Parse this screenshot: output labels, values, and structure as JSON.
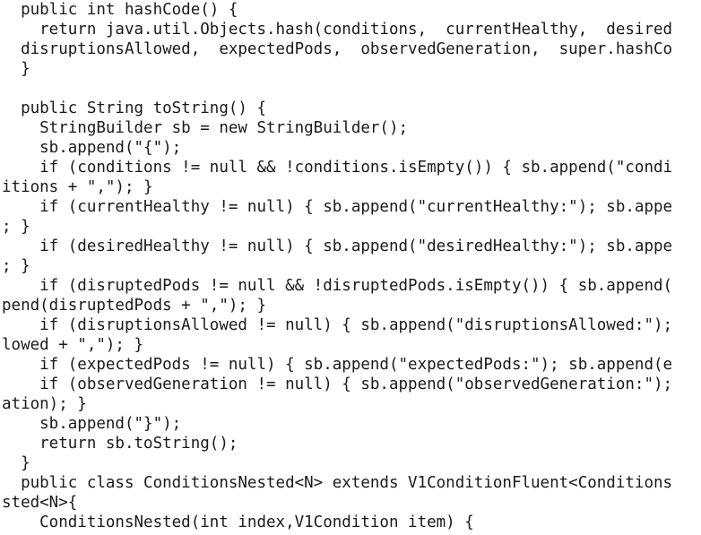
{
  "editor": {
    "lines": [
      "  public int hashCode() {",
      "    return java.util.Objects.hash(conditions,  currentHealthy,  desired",
      "  disruptionsAllowed,  expectedPods,  observedGeneration,  super.hashCo",
      "  }",
      "",
      "  public String toString() {",
      "    StringBuilder sb = new StringBuilder();",
      "    sb.append(\"{\");",
      "    if (conditions != null && !conditions.isEmpty()) { sb.append(\"condi",
      "itions + \",\"); }",
      "    if (currentHealthy != null) { sb.append(\"currentHealthy:\"); sb.appe",
      "; }",
      "    if (desiredHealthy != null) { sb.append(\"desiredHealthy:\"); sb.appe",
      "; }",
      "    if (disruptedPods != null && !disruptedPods.isEmpty()) { sb.append(",
      "pend(disruptedPods + \",\"); }",
      "    if (disruptionsAllowed != null) { sb.append(\"disruptionsAllowed:\");",
      "lowed + \",\"); }",
      "    if (expectedPods != null) { sb.append(\"expectedPods:\"); sb.append(e",
      "    if (observedGeneration != null) { sb.append(\"observedGeneration:\");",
      "ation); }",
      "    sb.append(\"}\");",
      "    return sb.toString();",
      "  }",
      "  public class ConditionsNested<N> extends V1ConditionFluent<Conditions",
      "sted<N>{",
      "    ConditionsNested(int index,V1Condition item) {"
    ]
  }
}
